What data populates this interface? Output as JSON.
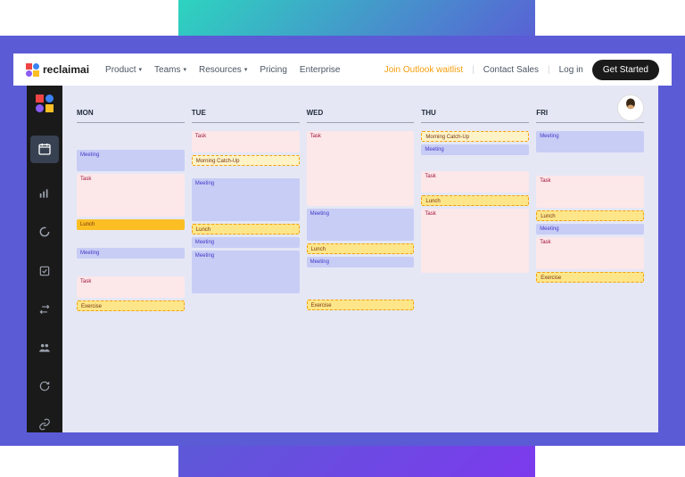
{
  "brand": "reclaimai",
  "nav": [
    "Product",
    "Teams",
    "Resources",
    "Pricing",
    "Enterprise"
  ],
  "nav_has_dropdown": [
    true,
    true,
    true,
    false,
    false
  ],
  "topRight": {
    "waitlist": "Join Outlook waitlist",
    "sales": "Contact Sales",
    "login": "Log in",
    "cta": "Get Started"
  },
  "days": [
    "MON",
    "TUE",
    "WED",
    "THU",
    "FRI"
  ],
  "events": {
    "MON": [
      {
        "label": "Meeting",
        "type": "meeting",
        "h": "h2"
      },
      {
        "label": "Task",
        "type": "task",
        "h": "h4"
      },
      {
        "label": "Lunch",
        "type": "lunch",
        "h": "h1"
      },
      {
        "label": "Meeting",
        "type": "meeting",
        "h": "h1"
      },
      {
        "label": "Task",
        "type": "task",
        "h": "h2"
      },
      {
        "label": "Exercise",
        "type": "exercise",
        "h": "h1"
      }
    ],
    "TUE": [
      {
        "label": "Task",
        "type": "task",
        "h": "h2"
      },
      {
        "label": "Morning Catch-Up",
        "type": "catchup",
        "h": "h1"
      },
      {
        "label": "Meeting",
        "type": "meeting",
        "h": "h4"
      },
      {
        "label": "Lunch",
        "type": "lunch dashed",
        "h": "h1"
      },
      {
        "label": "Meeting",
        "type": "meeting",
        "h": "h1"
      },
      {
        "label": "Meeting",
        "type": "meeting",
        "h": "h4"
      }
    ],
    "WED": [
      {
        "label": "Task",
        "type": "task",
        "h": "h7"
      },
      {
        "label": "Meeting",
        "type": "meeting",
        "h": "h3"
      },
      {
        "label": "Lunch",
        "type": "lunch dashed",
        "h": "h1"
      },
      {
        "label": "Meeting",
        "type": "meeting",
        "h": "h1"
      },
      {
        "label": "Exercise",
        "type": "exercise",
        "h": "h1"
      }
    ],
    "THU": [
      {
        "label": "Morning Catch-Up",
        "type": "catchup",
        "h": "h1"
      },
      {
        "label": "Meeting",
        "type": "meeting",
        "h": "h1"
      },
      {
        "label": "Task",
        "type": "task",
        "h": "h2"
      },
      {
        "label": "Lunch",
        "type": "lunch dashed",
        "h": "h1"
      },
      {
        "label": "Task",
        "type": "task",
        "h": "h6"
      }
    ],
    "FRI": [
      {
        "label": "Meeting",
        "type": "meeting",
        "h": "h2"
      },
      {
        "label": "Task",
        "type": "task",
        "h": "h3"
      },
      {
        "label": "Lunch",
        "type": "lunch dashed",
        "h": "h1"
      },
      {
        "label": "Meeting",
        "type": "meeting",
        "h": "h1"
      },
      {
        "label": "Task",
        "type": "task",
        "h": "h3"
      },
      {
        "label": "Exercise",
        "type": "exercise",
        "h": "h1"
      }
    ]
  }
}
